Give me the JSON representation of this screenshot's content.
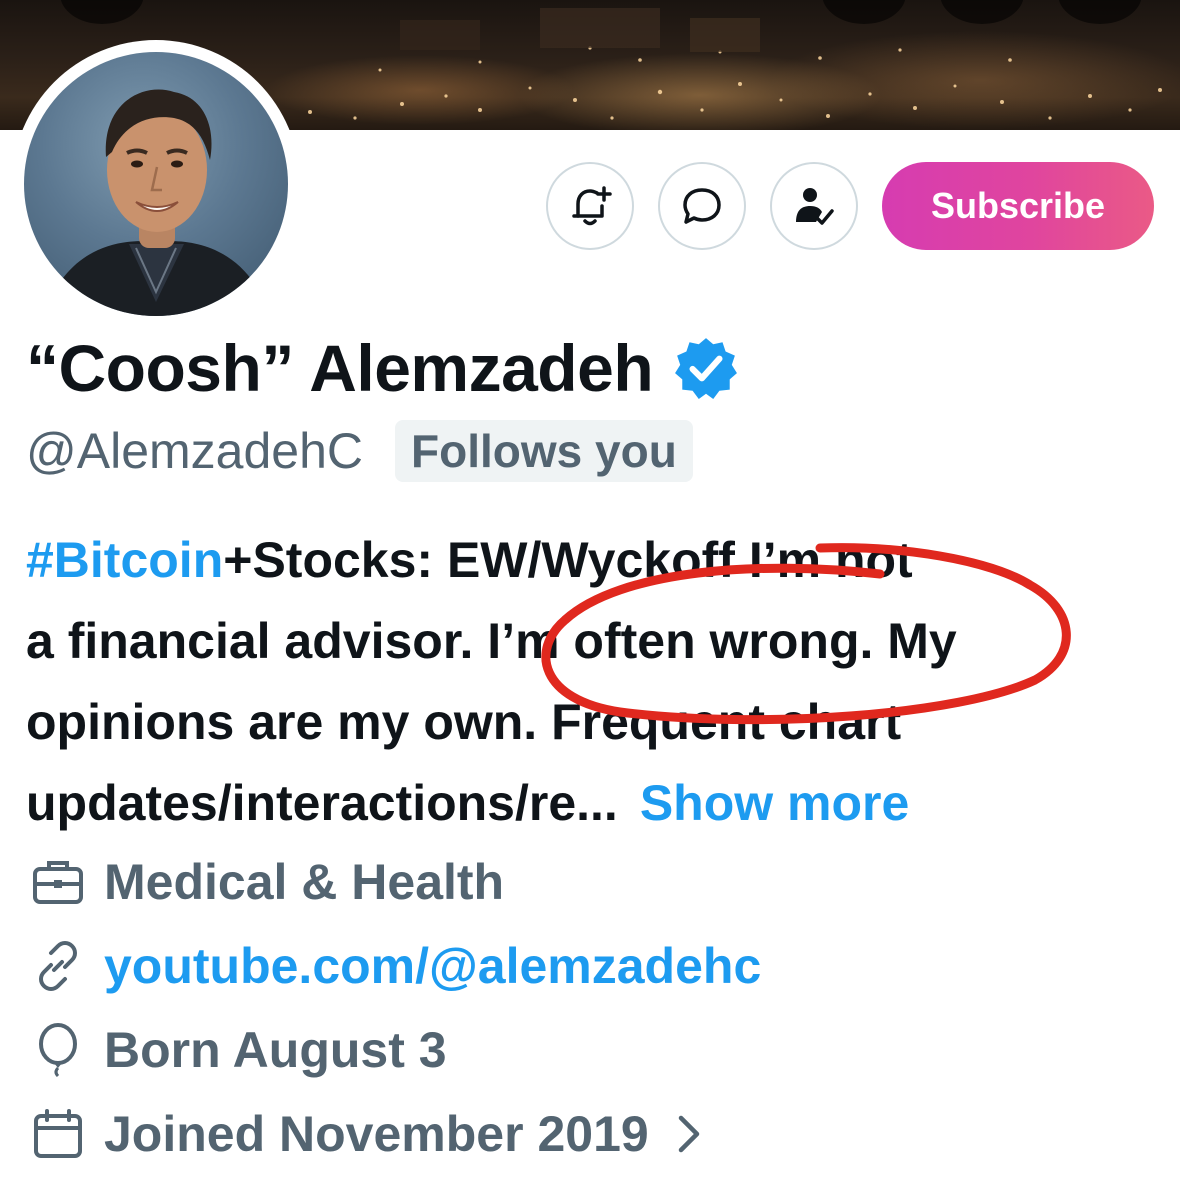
{
  "header": {
    "subscribe_label": "Subscribe"
  },
  "profile": {
    "display_name": "“Coosh” Alemzadeh",
    "handle": "@AlemzadehC",
    "follows_badge": "Follows you",
    "bio": {
      "line1_hashtag": "#Bitcoin",
      "line1_rest": "+Stocks: EW/Wyckoff I’m not",
      "line2": "a financial advisor. I’m often wrong. My",
      "line3": "opinions are my own. Frequent chart",
      "line4": "updates/interactions/re...",
      "show_more": "Show more"
    },
    "category": "Medical & Health",
    "website": "youtube.com/@alemzadehc",
    "birthday": "Born August 3",
    "joined": "Joined November 2019"
  },
  "colors": {
    "accent": "#1d9bf0",
    "subscribe_gradient_start": "#d63cb1",
    "subscribe_gradient_end": "#ea5a86",
    "annotation_red": "#e0281e",
    "secondary_text": "#536471"
  },
  "icons": {
    "notifications": "bell-plus-icon",
    "message": "chat-bubble-icon",
    "following": "person-check-icon",
    "verified": "verified-badge-icon",
    "category": "briefcase-icon",
    "website": "link-icon",
    "birthday": "balloon-icon",
    "joined": "calendar-icon",
    "joined_arrow": "chevron-right-icon"
  }
}
